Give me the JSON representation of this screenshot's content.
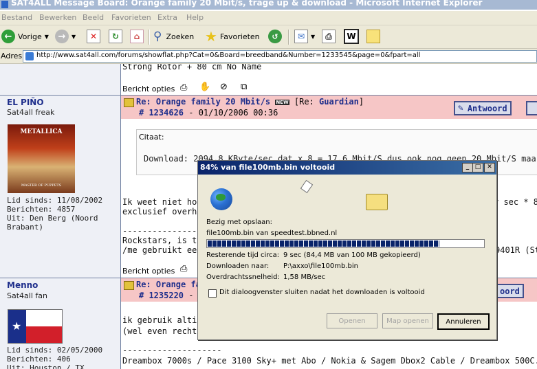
{
  "window": {
    "title": "SAT4ALL Message Board: Orange family 20 Mbit/s, trage up & download - Microsoft Internet Explorer"
  },
  "menu": [
    "Bestand",
    "Bewerken",
    "Beeld",
    "Favorieten",
    "Extra",
    "Help"
  ],
  "toolbar": {
    "back_label": "Vorige",
    "search_label": "Zoeken",
    "favorites_label": "Favorieten"
  },
  "address": {
    "label": "Adres",
    "url": "http://www.sat4all.com/forums/showflat.php?Cat=0&Board=breedband&Number=1233545&page=0&fpart=all"
  },
  "page": {
    "top_cut_text": "Strong Rotor + 80 cm No Name",
    "options_label": "Bericht opties",
    "post1": {
      "username": "EL PIÑO",
      "rank": "Sat4all freak",
      "avatar_top": "METALLICA",
      "avatar_bottom": "MASTER OF PUPPETS",
      "lid": "Lid sinds: 11/08/2002",
      "berichten": "Berichten: 4857",
      "uit1": "Uit: Den Berg (Noord",
      "uit2": "Brabant)",
      "subject": "Re: Orange family 20 Mbit/s",
      "new_badge": "NEW",
      "re_prefix": "[Re: ",
      "re_name": "Guardian",
      "re_suffix": "]",
      "number": "# 1234626",
      "date": " - 01/10/2006 00:36",
      "reply_label": "Antwoord",
      "citaat_label": "Citaat:",
      "quote_text": "Download: 2094,8 KByte/sec dat x 8 = 17,6 Mbit/S dus ook nog geen 20 Mbit/S maar geen",
      "body1": "Ik weet niet hoe",
      "body1_right": "r sec * 8 =",
      "body2": "exclusief overhea",
      "sig_line": "--------------------",
      "sig1": "Rockstars, is ther",
      "sig2": "/me gebruikt een",
      "sig2_right": "9401R (St"
    },
    "post2": {
      "username": "Menno",
      "rank": "Sat4all fan",
      "lid": "Lid sinds: 02/05/2000",
      "berichten": "Berichten: 406",
      "uit": "Uit: Houston / TX",
      "subject": "Re: Orange fa",
      "number": "# 1235220",
      "date": " - 0",
      "reply_label": "oord",
      "body1": "ik gebruik altijd d",
      "body2": "(wel even rechts",
      "sig_line": "--------------------",
      "sig": "Dreambox 7000s / Pace 3100 Sky+ met Abo / Nokia & Sagem Dbox2 Cable / Dreambox 500C."
    }
  },
  "dialog": {
    "title": "84% van file100mb.bin voltooid",
    "saving_label": "Bezig met opslaan:",
    "saving_value": "file100mb.bin van speedtest.bbned.nl",
    "progress": 0.84,
    "remaining_label": "Resterende tijd circa:",
    "remaining_value": "9 sec (84,4 MB van 100 MB gekopieerd)",
    "download_to_label": "Downloaden naar:",
    "download_to_value": "P:\\axxo\\file100mb.bin",
    "speed_label": "Overdrachtssnelheid:",
    "speed_value": "1,58 MB/sec",
    "checkbox_label": "Dit dialoogvenster sluiten nadat het downloaden is voltooid",
    "btn_open": "Openen",
    "btn_open_folder": "Map openen",
    "btn_cancel": "Annuleren"
  }
}
